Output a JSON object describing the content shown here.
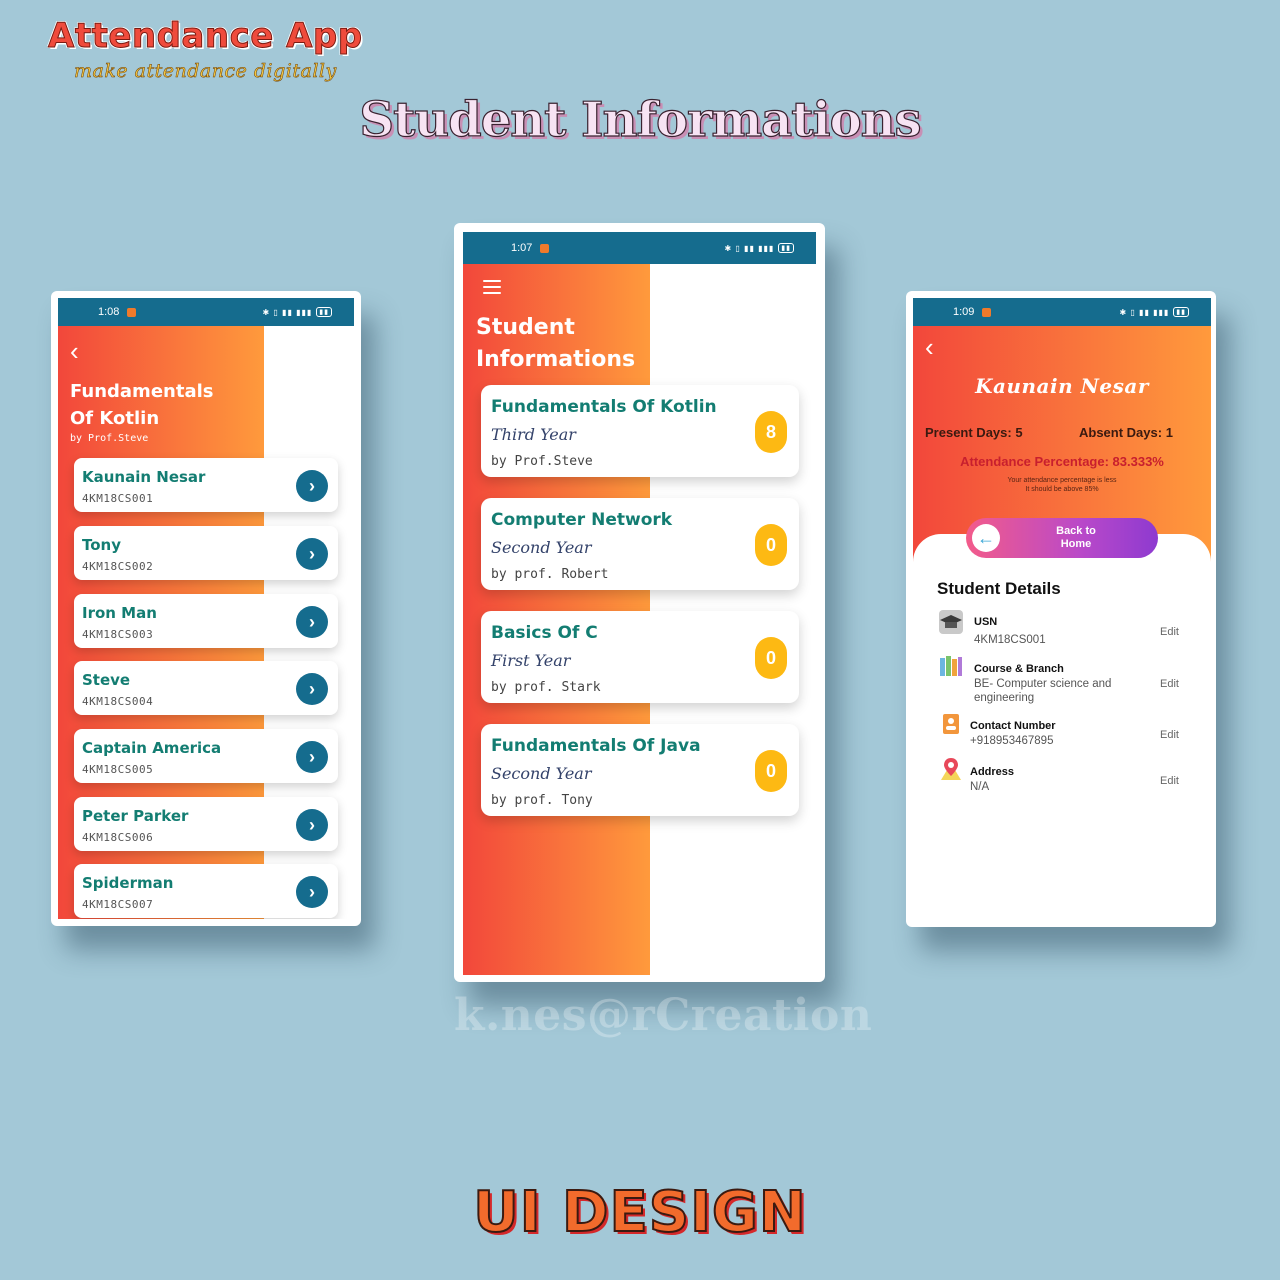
{
  "header": {
    "app_title": "Attendance App",
    "tagline": "make attendance digitally",
    "main_heading": "Student Informations"
  },
  "watermark": "k.nes@rCreation",
  "footer_title": "UI DESIGN",
  "colors": {
    "background": "#a3c8d7",
    "status_bar": "#156c8e",
    "gradient_start": "#f2473b",
    "gradient_end": "#ff9a3c",
    "title_teal": "#137d72",
    "badge_yellow": "#fdb913",
    "percentage_red": "#c81f2e"
  },
  "left_phone": {
    "status_time": "1:08",
    "course_title_line1": "Fundamentals",
    "course_title_line2": "Of Kotlin",
    "course_prof": "by Prof.Steve",
    "students": [
      {
        "name": "Kaunain Nesar",
        "usn": "4KM18CS001"
      },
      {
        "name": "Tony",
        "usn": "4KM18CS002"
      },
      {
        "name": "Iron Man",
        "usn": "4KM18CS003"
      },
      {
        "name": "Steve",
        "usn": "4KM18CS004"
      },
      {
        "name": "Captain America",
        "usn": "4KM18CS005"
      },
      {
        "name": "Peter Parker",
        "usn": "4KM18CS006"
      },
      {
        "name": "Spiderman",
        "usn": "4KM18CS007"
      }
    ]
  },
  "center_phone": {
    "status_time": "1:07",
    "screen_title_line1": "Student",
    "screen_title_line2": "Informations",
    "subjects": [
      {
        "name": "Fundamentals Of Kotlin",
        "year": "Third Year",
        "prof": "by Prof.Steve",
        "count": "8"
      },
      {
        "name": "Computer Network",
        "year": "Second Year",
        "prof": "by prof. Robert",
        "count": "0"
      },
      {
        "name": "Basics Of C",
        "year": "First Year",
        "prof": "by prof. Stark",
        "count": "0"
      },
      {
        "name": "Fundamentals Of Java",
        "year": "Second Year",
        "prof": "by prof. Tony",
        "count": "0"
      }
    ]
  },
  "right_phone": {
    "status_time": "1:09",
    "student_name": "Kaunain Nesar",
    "present_days": "Present Days: 5",
    "absent_days": "Absent Days: 1",
    "attendance_percentage": "Attendance Percentage: 83.333%",
    "note_line1": "Your attendance percentage is less",
    "note_line2": "It should be above 85%",
    "back_home_line1": "Back to",
    "back_home_line2": "Home",
    "details_title": "Student Details",
    "details": [
      {
        "label": "USN",
        "value": "4KM18CS001",
        "edit": "Edit",
        "icon": "graduation-cap-icon"
      },
      {
        "label": "Course & Branch",
        "value_line1": "BE- Computer science and",
        "value_line2": "engineering",
        "edit": "Edit",
        "icon": "books-icon"
      },
      {
        "label": "Contact Number",
        "value": "+918953467895",
        "edit": "Edit",
        "icon": "contact-card-icon"
      },
      {
        "label": "Address",
        "value": "N/A",
        "edit": "Edit",
        "icon": "map-pin-icon"
      }
    ]
  }
}
